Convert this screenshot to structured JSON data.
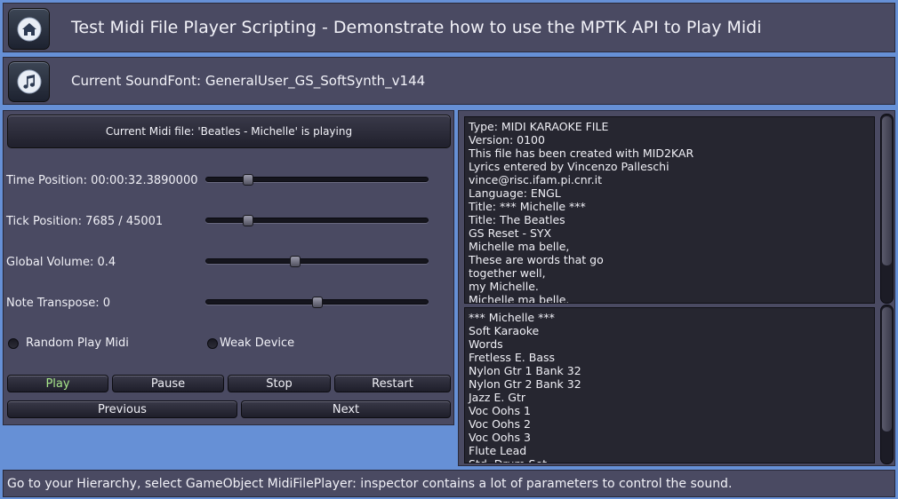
{
  "header": {
    "title": "Test Midi File Player Scripting - Demonstrate how to use the MPTK API to Play Midi",
    "home_icon": "home-icon"
  },
  "soundfont": {
    "label": "Current SoundFont: GeneralUser_GS_SoftSynth_v144",
    "music_icon": "music-note-icon"
  },
  "player": {
    "current_file": "Current Midi file: 'Beatles - Michelle' is playing",
    "sliders": [
      {
        "label": "Time Position: 00:00:32.3890000",
        "value": 0.19
      },
      {
        "label": "Tick Position: 7685 / 45001",
        "value": 0.19
      },
      {
        "label": "Global Volume: 0.4",
        "value": 0.4
      },
      {
        "label": "Note Transpose: 0",
        "value": 0.5
      }
    ],
    "random_play": {
      "label": "Random Play Midi",
      "checked": false
    },
    "weak_device": {
      "label": "Weak Device",
      "checked": false
    },
    "buttons": {
      "play": "Play",
      "pause": "Pause",
      "stop": "Stop",
      "restart": "Restart",
      "previous": "Previous",
      "next": "Next"
    },
    "play_color": "#a7e68a"
  },
  "info": {
    "header_lines": [
      "Type: MIDI KARAOKE FILE",
      "Version: 0100",
      "This file has been created with MID2KAR",
      "Lyrics entered by  Vincenzo Palleschi",
      "vince@risc.ifam.pi.cnr.it",
      "Language: ENGL",
      "Title: ***  Michelle  ***",
      "Title: The Beatles",
      "GS Reset - SYX",
      "Michelle ma belle,",
      "These are words that go",
      "together well,",
      "my Michelle.",
      "Michelle ma belle."
    ],
    "track_lines": [
      "***  Michelle  ***",
      "Soft Karaoke",
      "Words",
      "Fretless E. Bass",
      "Nylon Gtr 1 Bank 32",
      "Nylon Gtr 2 Bank 32",
      "Jazz E. Gtr",
      "Voc Oohs 1",
      "Voc Oohs 2",
      "Voc Oohs 3",
      "Flute Lead",
      "Std. Drum Set"
    ]
  },
  "footer": {
    "text": "Go to your Hierarchy, select GameObject MidiFilePlayer: inspector contains a lot of parameters to control the sound."
  }
}
